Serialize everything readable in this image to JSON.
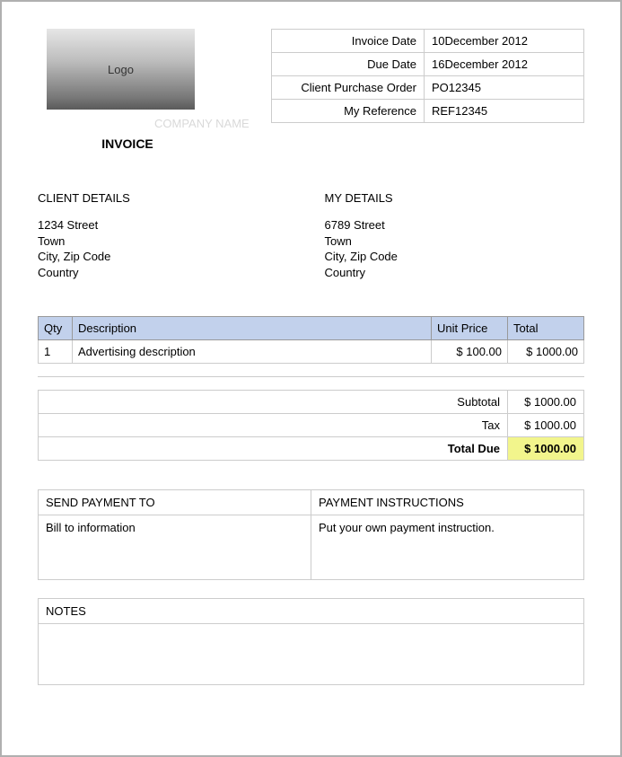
{
  "logo_text": "Logo",
  "company_name": "COMPANY NAME",
  "invoice_title": "INVOICE",
  "ref": {
    "invoice_date_label": "Invoice Date",
    "invoice_date": "10December  2012",
    "due_date_label": "Due Date",
    "due_date": "16December  2012",
    "po_label": "Client Purchase Order",
    "po": "PO12345",
    "my_ref_label": "My Reference",
    "my_ref": "REF12345"
  },
  "client": {
    "heading": "CLIENT DETAILS",
    "line1": "1234 Street",
    "line2": "Town",
    "line3": "City, Zip Code",
    "line4": "Country"
  },
  "mine": {
    "heading": "MY DETAILS",
    "line1": "6789 Street",
    "line2": "Town",
    "line3": "City, Zip Code",
    "line4": "Country"
  },
  "items": {
    "headers": {
      "qty": "Qty",
      "desc": "Description",
      "unit": "Unit Price",
      "total": "Total"
    },
    "rows": [
      {
        "qty": "1",
        "desc": "Advertising description",
        "unit": "$ 100.00",
        "total": "$ 1000.00"
      }
    ]
  },
  "totals": {
    "subtotal_label": "Subtotal",
    "subtotal": "$ 1000.00",
    "tax_label": "Tax",
    "tax": "$ 1000.00",
    "total_due_label": "Total Due",
    "total_due": "$ 1000.00"
  },
  "payment": {
    "send_to_label": "SEND PAYMENT TO",
    "send_to_body": "Bill to information",
    "instructions_label": "PAYMENT INSTRUCTIONS",
    "instructions_body": "Put your own payment instruction."
  },
  "notes": {
    "label": "NOTES",
    "body": ""
  }
}
